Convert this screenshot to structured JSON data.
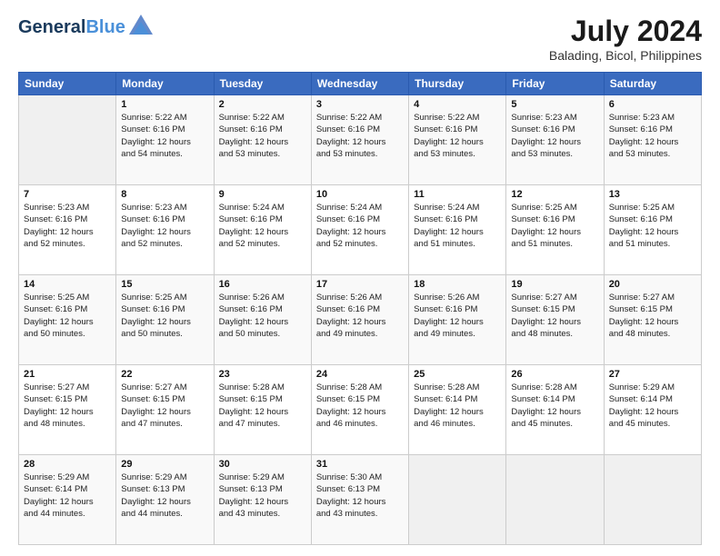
{
  "header": {
    "logo_line1": "General",
    "logo_line2": "Blue",
    "month_year": "July 2024",
    "location": "Balading, Bicol, Philippines"
  },
  "days_of_week": [
    "Sunday",
    "Monday",
    "Tuesday",
    "Wednesday",
    "Thursday",
    "Friday",
    "Saturday"
  ],
  "weeks": [
    [
      {
        "day": "",
        "info": ""
      },
      {
        "day": "1",
        "info": "Sunrise: 5:22 AM\nSunset: 6:16 PM\nDaylight: 12 hours\nand 54 minutes."
      },
      {
        "day": "2",
        "info": "Sunrise: 5:22 AM\nSunset: 6:16 PM\nDaylight: 12 hours\nand 53 minutes."
      },
      {
        "day": "3",
        "info": "Sunrise: 5:22 AM\nSunset: 6:16 PM\nDaylight: 12 hours\nand 53 minutes."
      },
      {
        "day": "4",
        "info": "Sunrise: 5:22 AM\nSunset: 6:16 PM\nDaylight: 12 hours\nand 53 minutes."
      },
      {
        "day": "5",
        "info": "Sunrise: 5:23 AM\nSunset: 6:16 PM\nDaylight: 12 hours\nand 53 minutes."
      },
      {
        "day": "6",
        "info": "Sunrise: 5:23 AM\nSunset: 6:16 PM\nDaylight: 12 hours\nand 53 minutes."
      }
    ],
    [
      {
        "day": "7",
        "info": "Sunrise: 5:23 AM\nSunset: 6:16 PM\nDaylight: 12 hours\nand 52 minutes."
      },
      {
        "day": "8",
        "info": "Sunrise: 5:23 AM\nSunset: 6:16 PM\nDaylight: 12 hours\nand 52 minutes."
      },
      {
        "day": "9",
        "info": "Sunrise: 5:24 AM\nSunset: 6:16 PM\nDaylight: 12 hours\nand 52 minutes."
      },
      {
        "day": "10",
        "info": "Sunrise: 5:24 AM\nSunset: 6:16 PM\nDaylight: 12 hours\nand 52 minutes."
      },
      {
        "day": "11",
        "info": "Sunrise: 5:24 AM\nSunset: 6:16 PM\nDaylight: 12 hours\nand 51 minutes."
      },
      {
        "day": "12",
        "info": "Sunrise: 5:25 AM\nSunset: 6:16 PM\nDaylight: 12 hours\nand 51 minutes."
      },
      {
        "day": "13",
        "info": "Sunrise: 5:25 AM\nSunset: 6:16 PM\nDaylight: 12 hours\nand 51 minutes."
      }
    ],
    [
      {
        "day": "14",
        "info": "Sunrise: 5:25 AM\nSunset: 6:16 PM\nDaylight: 12 hours\nand 50 minutes."
      },
      {
        "day": "15",
        "info": "Sunrise: 5:25 AM\nSunset: 6:16 PM\nDaylight: 12 hours\nand 50 minutes."
      },
      {
        "day": "16",
        "info": "Sunrise: 5:26 AM\nSunset: 6:16 PM\nDaylight: 12 hours\nand 50 minutes."
      },
      {
        "day": "17",
        "info": "Sunrise: 5:26 AM\nSunset: 6:16 PM\nDaylight: 12 hours\nand 49 minutes."
      },
      {
        "day": "18",
        "info": "Sunrise: 5:26 AM\nSunset: 6:16 PM\nDaylight: 12 hours\nand 49 minutes."
      },
      {
        "day": "19",
        "info": "Sunrise: 5:27 AM\nSunset: 6:15 PM\nDaylight: 12 hours\nand 48 minutes."
      },
      {
        "day": "20",
        "info": "Sunrise: 5:27 AM\nSunset: 6:15 PM\nDaylight: 12 hours\nand 48 minutes."
      }
    ],
    [
      {
        "day": "21",
        "info": "Sunrise: 5:27 AM\nSunset: 6:15 PM\nDaylight: 12 hours\nand 48 minutes."
      },
      {
        "day": "22",
        "info": "Sunrise: 5:27 AM\nSunset: 6:15 PM\nDaylight: 12 hours\nand 47 minutes."
      },
      {
        "day": "23",
        "info": "Sunrise: 5:28 AM\nSunset: 6:15 PM\nDaylight: 12 hours\nand 47 minutes."
      },
      {
        "day": "24",
        "info": "Sunrise: 5:28 AM\nSunset: 6:15 PM\nDaylight: 12 hours\nand 46 minutes."
      },
      {
        "day": "25",
        "info": "Sunrise: 5:28 AM\nSunset: 6:14 PM\nDaylight: 12 hours\nand 46 minutes."
      },
      {
        "day": "26",
        "info": "Sunrise: 5:28 AM\nSunset: 6:14 PM\nDaylight: 12 hours\nand 45 minutes."
      },
      {
        "day": "27",
        "info": "Sunrise: 5:29 AM\nSunset: 6:14 PM\nDaylight: 12 hours\nand 45 minutes."
      }
    ],
    [
      {
        "day": "28",
        "info": "Sunrise: 5:29 AM\nSunset: 6:14 PM\nDaylight: 12 hours\nand 44 minutes."
      },
      {
        "day": "29",
        "info": "Sunrise: 5:29 AM\nSunset: 6:13 PM\nDaylight: 12 hours\nand 44 minutes."
      },
      {
        "day": "30",
        "info": "Sunrise: 5:29 AM\nSunset: 6:13 PM\nDaylight: 12 hours\nand 43 minutes."
      },
      {
        "day": "31",
        "info": "Sunrise: 5:30 AM\nSunset: 6:13 PM\nDaylight: 12 hours\nand 43 minutes."
      },
      {
        "day": "",
        "info": ""
      },
      {
        "day": "",
        "info": ""
      },
      {
        "day": "",
        "info": ""
      }
    ]
  ]
}
